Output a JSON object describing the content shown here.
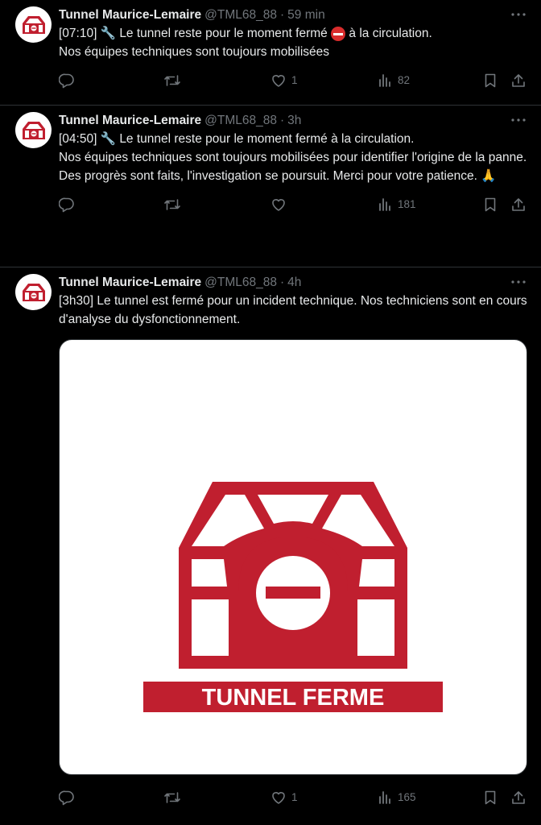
{
  "tweets": [
    {
      "name": "Tunnel Maurice-Lemaire",
      "handle": "@TML68_88",
      "separator": "·",
      "time": "59 min",
      "text_part1": "[07:10] 🔧 Le tunnel reste pour le moment fermé ",
      "text_emoji": "⛔",
      "text_part2": " à la circulation.\nNos équipes techniques sont toujours mobilisées",
      "replies": "",
      "retweets": "",
      "likes": "1",
      "views": "82"
    },
    {
      "name": "Tunnel Maurice-Lemaire",
      "handle": "@TML68_88",
      "separator": "·",
      "time": "3h",
      "text": "[04:50] 🔧 Le tunnel reste pour le moment fermé à la circulation.\nNos équipes techniques sont toujours mobilisées pour identifier l'origine de la panne.\nDes progrès sont faits, l'investigation se poursuit. Merci pour votre patience. 🙏",
      "replies": "",
      "retweets": "",
      "likes": "",
      "views": "181"
    },
    {
      "name": "Tunnel Maurice-Lemaire",
      "handle": "@TML68_88",
      "separator": "·",
      "time": "4h",
      "text": "[3h30] Le tunnel est fermé pour un incident technique. Nos techniciens sont en cours d'analyse du dysfonctionnement.",
      "image_caption": "TUNNEL FERME",
      "replies": "",
      "retweets": "",
      "likes": "1",
      "views": "165"
    }
  ],
  "colors": {
    "background": "#000000",
    "text": "#e7e9ea",
    "muted": "#71767b",
    "border": "#2f3336",
    "brand_red": "#c01f2f"
  },
  "icons": [
    "tunnel-logo-icon",
    "more-icon",
    "reply-icon",
    "retweet-icon",
    "like-icon",
    "views-icon",
    "bookmark-icon",
    "share-icon"
  ]
}
